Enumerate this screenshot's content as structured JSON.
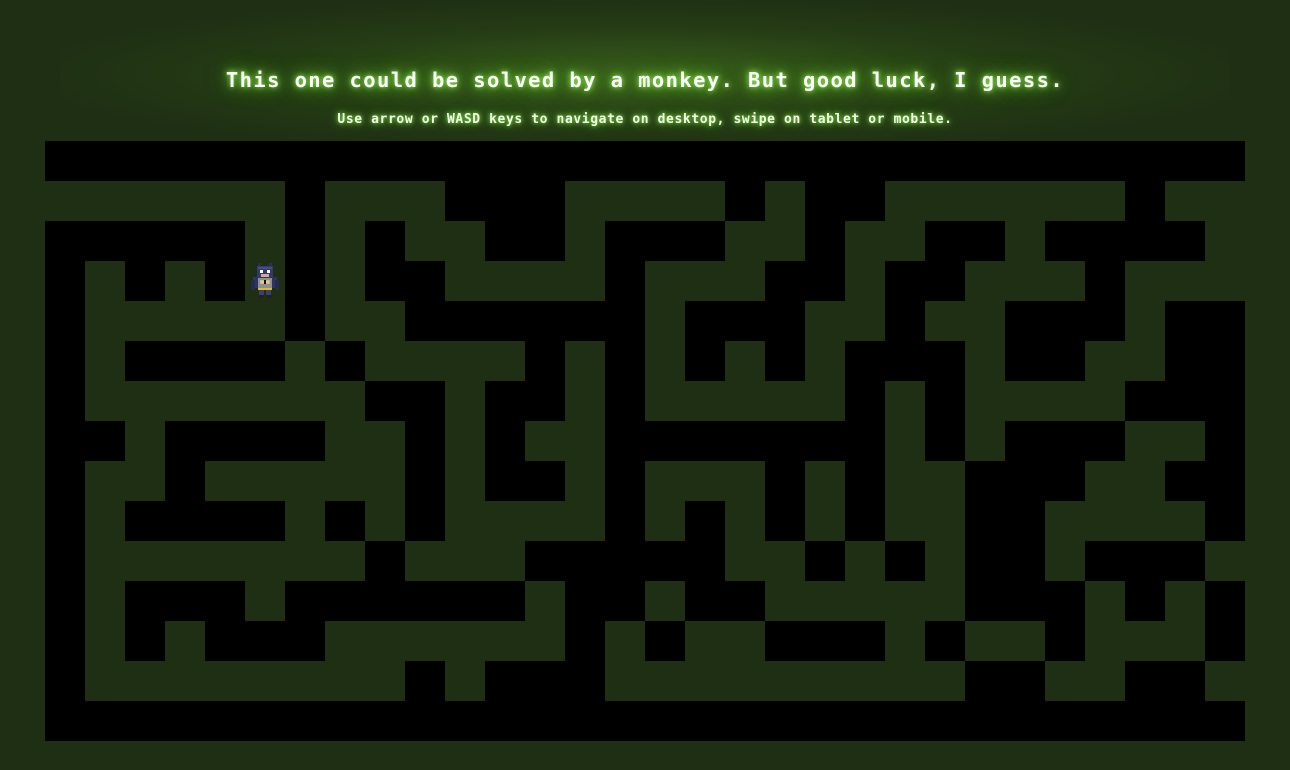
{
  "header": {
    "title": "This one could be solved by a monkey. But good luck, I guess.",
    "instructions": "Use arrow or WASD keys to navigate on desktop, swipe on tablet or mobile."
  },
  "colors": {
    "background": "#1f2f14",
    "wall": "#000000",
    "path": "#1f2f14",
    "glow": "#7cff3a"
  },
  "maze": {
    "cols": 30,
    "rows": 15,
    "walls": [
      "XXXXXXXXXXXXXXXXXXXXXXXXXXXXXX",
      "......X...XXX....X.XX......X..",
      "XXXXX.X.X..XX.XXX..X..XX.XXXX.",
      "X.X.X.X.XX....X...XX.XX...X...",
      "X.....X..XXXXXX.XXX..X..XXX.XX",
      "X.XXXX.X....X.X.X.X.XXX.XX..XX",
      "X.......XX.XX.X.....X.X....XXX",
      "XX.XXXX..X.X..XXXXXXX.X.XXX..X",
      "X..X.....X.XX.X...X.X..XXX..XX",
      "X.XXXX.X.X....X.X.X.X..XX....X",
      "X.......X...XXXXX..X.X.XX.XXX.",
      "X.XXX.XXXXXX.XX.XX.....XXX.X.X",
      "X.X.XXX......X.X..XXX.X..X...X",
      "X........X.XXX.........XX..XX.",
      "XXXXXXXXXXXXXXXXXXXXXXXXXXXXXX"
    ],
    "player_cell": [
      5,
      3
    ]
  },
  "player": {
    "icon": "batman-sprite-icon"
  }
}
